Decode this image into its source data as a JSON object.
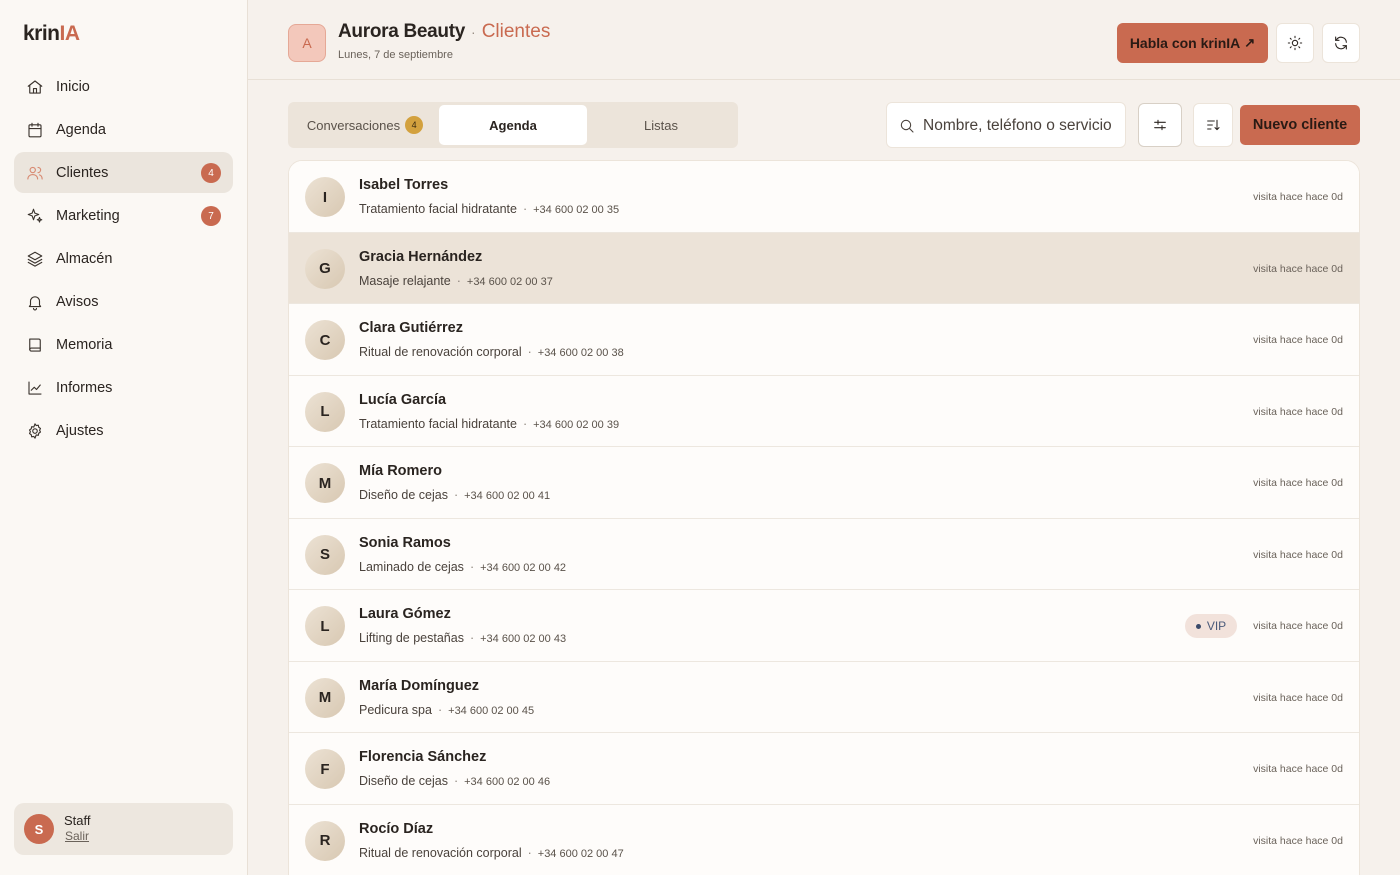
{
  "app": {
    "logo_main": "krin",
    "logo_accent": "IA"
  },
  "sidebar": {
    "items": [
      {
        "label": "Inicio",
        "icon": "home-icon"
      },
      {
        "label": "Agenda",
        "icon": "calendar-icon"
      },
      {
        "label": "Clientes",
        "icon": "users-icon",
        "badge": "4",
        "active": true
      },
      {
        "label": "Marketing",
        "icon": "sparkles-icon",
        "badge": "7"
      },
      {
        "label": "Almacén",
        "icon": "layers-icon"
      },
      {
        "label": "Avisos",
        "icon": "bell-icon"
      },
      {
        "label": "Memoria",
        "icon": "book-icon"
      },
      {
        "label": "Informes",
        "icon": "chart-icon"
      },
      {
        "label": "Ajustes",
        "icon": "gear-icon"
      }
    ],
    "staff": {
      "avatar": "S",
      "name": "Staff",
      "logout": "Salir"
    }
  },
  "header": {
    "avatar": "A",
    "business": "Aurora Beauty",
    "separator": "·",
    "section": "Clientes",
    "date": "Lunes, 7 de septiembre",
    "talk_button": "Habla con krinIA",
    "talk_arrow": "↗"
  },
  "toolbar": {
    "tabs": [
      {
        "label": "Conversaciones",
        "badge": "4"
      },
      {
        "label": "Agenda",
        "active": true
      },
      {
        "label": "Listas"
      }
    ],
    "search_placeholder": "Nombre, teléfono o servicio",
    "new_client": "Nuevo cliente"
  },
  "clients": [
    {
      "initial": "I",
      "name": "Isabel Torres",
      "service": "Tratamiento facial hidratante",
      "phone": "+34 600 02 00 35",
      "visit": "visita hace hace 0d"
    },
    {
      "initial": "G",
      "name": "Gracia Hernández",
      "service": "Masaje relajante",
      "phone": "+34 600 02 00 37",
      "visit": "visita hace hace 0d",
      "selected": true
    },
    {
      "initial": "C",
      "name": "Clara Gutiérrez",
      "service": "Ritual de renovación corporal",
      "phone": "+34 600 02 00 38",
      "visit": "visita hace hace 0d"
    },
    {
      "initial": "L",
      "name": "Lucía García",
      "service": "Tratamiento facial hidratante",
      "phone": "+34 600 02 00 39",
      "visit": "visita hace hace 0d"
    },
    {
      "initial": "M",
      "name": "Mía Romero",
      "service": "Diseño de cejas",
      "phone": "+34 600 02 00 41",
      "visit": "visita hace hace 0d"
    },
    {
      "initial": "S",
      "name": "Sonia Ramos",
      "service": "Laminado de cejas",
      "phone": "+34 600 02 00 42",
      "visit": "visita hace hace 0d"
    },
    {
      "initial": "L",
      "name": "Laura Gómez",
      "service": "Lifting de pestañas",
      "phone": "+34 600 02 00 43",
      "visit": "visita hace hace 0d",
      "tag": "VIP"
    },
    {
      "initial": "M",
      "name": "María Domínguez",
      "service": "Pedicura spa",
      "phone": "+34 600 02 00 45",
      "visit": "visita hace hace 0d"
    },
    {
      "initial": "F",
      "name": "Florencia Sánchez",
      "service": "Diseño de cejas",
      "phone": "+34 600 02 00 46",
      "visit": "visita hace hace 0d"
    },
    {
      "initial": "R",
      "name": "Rocío Díaz",
      "service": "Ritual de renovación corporal",
      "phone": "+34 600 02 00 47",
      "visit": "visita hace hace 0d"
    }
  ],
  "colors": {
    "accent": "#c96a50",
    "badge_gold": "#d3a13e",
    "selected_row": "#ece3d8"
  }
}
